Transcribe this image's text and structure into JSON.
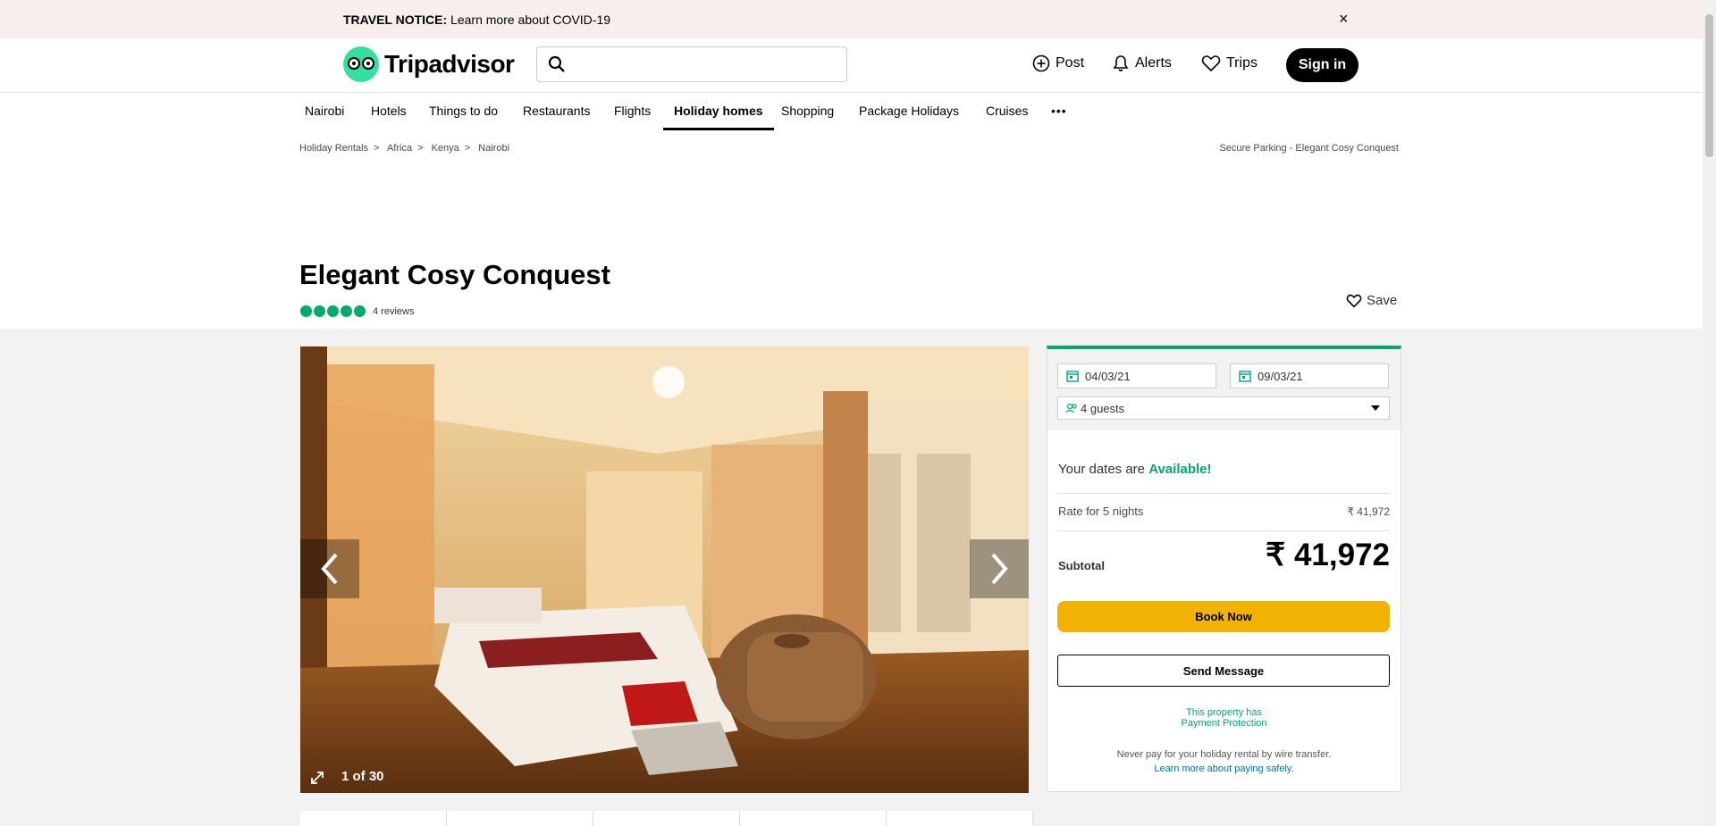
{
  "notice": {
    "bold": "TRAVEL NOTICE:",
    "text": " Learn more about COVID-19",
    "close": "×"
  },
  "brand": {
    "logo_text": "Tripadvisor",
    "accent": "#34e0a1"
  },
  "search": {
    "placeholder": ""
  },
  "header_nav": {
    "post": "Post",
    "alerts": "Alerts",
    "trips": "Trips",
    "signin": "Sign in"
  },
  "categories": [
    "Nairobi",
    "Hotels",
    "Things to do",
    "Restaurants",
    "Flights",
    "Holiday homes",
    "Shopping",
    "Package Holidays",
    "Cruises"
  ],
  "active_category": "Holiday homes",
  "more_icon": "•••",
  "breadcrumbs": [
    "Holiday Rentals",
    "Africa",
    "Kenya",
    "Nairobi"
  ],
  "breadcrumb_right": "Secure Parking - Elegant Cosy Conquest",
  "listing": {
    "title": "Elegant Cosy Conquest",
    "rating": 5,
    "reviews": "4 reviews",
    "save": "Save"
  },
  "photo": {
    "counter": "1 of 30"
  },
  "booking": {
    "checkin": "04/03/21",
    "checkout": "09/03/21",
    "guests": "4 guests",
    "avail_prefix": "Your dates are ",
    "avail_status": "Available!",
    "rate_label": "Rate for 5 nights",
    "rate_value": "₹ 41,972",
    "subtotal_label": "Subtotal",
    "subtotal_value": "₹ 41,972",
    "book_now": "Book Now",
    "send_message": "Send Message",
    "protect_line1": "This property has",
    "protect_line2": "Payment Protection",
    "never_text": "Never pay for your holiday rental by wire transfer.",
    "learn_more": "Learn more about paying safely.",
    "accent": "#00aa6c",
    "book_color": "#f2b203"
  }
}
